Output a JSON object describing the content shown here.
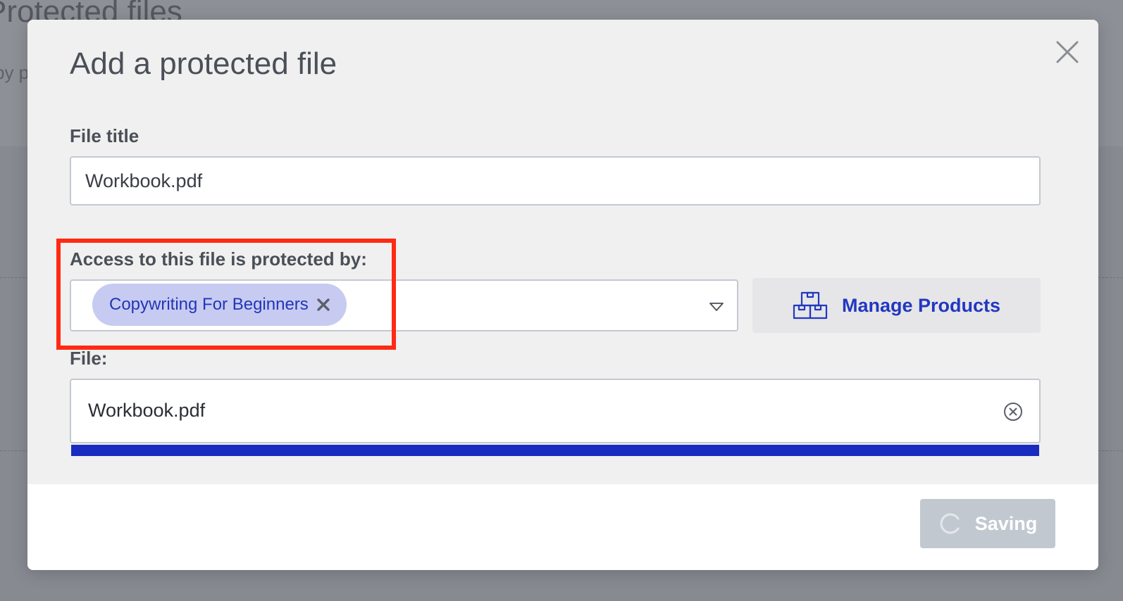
{
  "background": {
    "page_title": "Protected files",
    "page_subtitle": "by product"
  },
  "modal": {
    "title": "Add a protected file",
    "file_title_label": "File title",
    "file_title_value": "Workbook.pdf",
    "access_label": "Access to this file is protected by:",
    "selected_products": [
      "Copywriting For Beginners"
    ],
    "manage_products_label": "Manage Products",
    "file_label": "File:",
    "file_name": "Workbook.pdf",
    "upload_progress": 1.0,
    "saving_label": "Saving"
  },
  "colors": {
    "accent": "#2238c0",
    "chip_background": "#c7cbf1",
    "progress_fill": "#1a2bbf",
    "highlight": "#ff2a14",
    "disabled_button": "#c2c8d0"
  },
  "icons": {
    "close": "close-icon",
    "chip_remove": "remove-x-icon",
    "dropdown": "chevron-down-icon",
    "manage_products": "boxes-icon",
    "file_clear": "clear-circle-icon",
    "saving": "spinner-icon"
  }
}
